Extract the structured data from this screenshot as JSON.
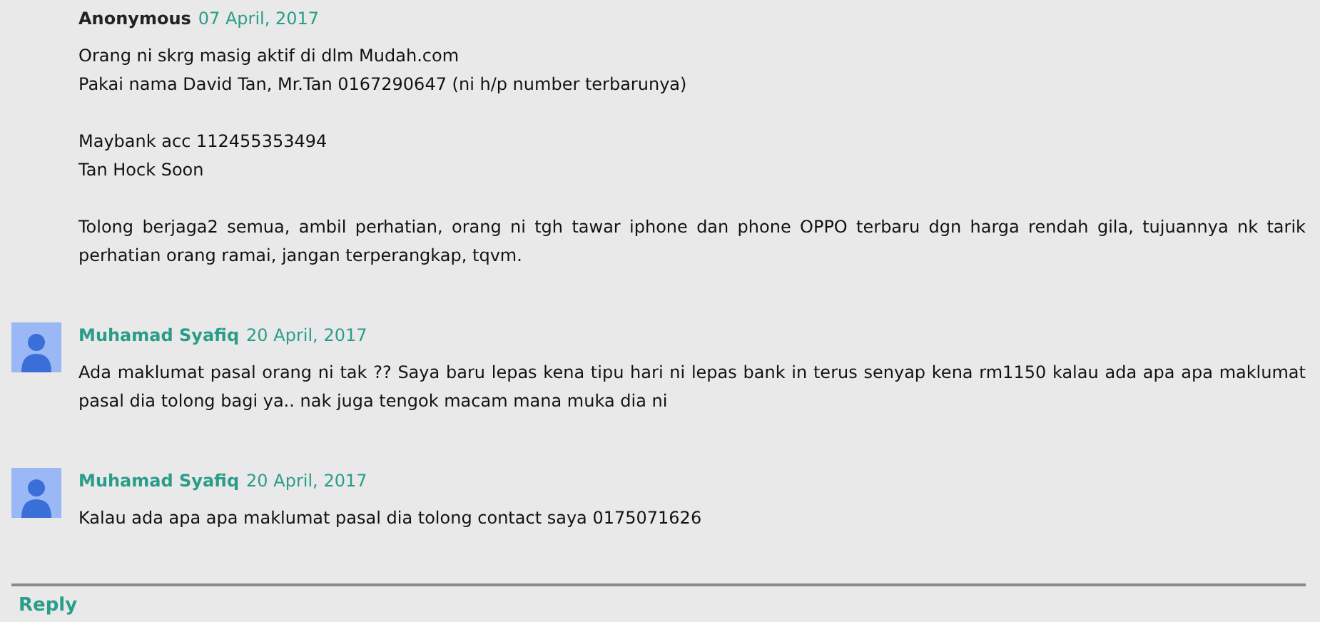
{
  "comments": [
    {
      "author": "Anonymous",
      "has_profile": false,
      "avatar": false,
      "date": "07 April, 2017",
      "paragraphs": [
        "Orang ni skrg masig aktif di dlm Mudah.com\nPakai nama David Tan, Mr.Tan 0167290647 (ni h/p number terbarunya)",
        "Maybank acc 112455353494\nTan Hock Soon",
        "Tolong berjaga2 semua, ambil perhatian, orang ni tgh tawar iphone dan phone OPPO terbaru dgn harga rendah gila, tujuannya nk tarik perhatian orang ramai, jangan terperangkap, tqvm."
      ]
    },
    {
      "author": "Muhamad Syafiq",
      "has_profile": true,
      "avatar": true,
      "date": "20 April, 2017",
      "paragraphs": [
        "Ada maklumat pasal orang ni tak ?? Saya baru lepas kena tipu hari ni lepas bank in terus senyap kena rm1150 kalau ada apa apa maklumat pasal dia tolong bagi ya.. nak juga tengok macam mana muka dia ni"
      ]
    },
    {
      "author": "Muhamad Syafiq",
      "has_profile": true,
      "avatar": true,
      "date": "20 April, 2017",
      "paragraphs": [
        "Kalau ada apa apa maklumat pasal dia tolong contact saya 0175071626"
      ]
    }
  ],
  "reply": "Reply"
}
